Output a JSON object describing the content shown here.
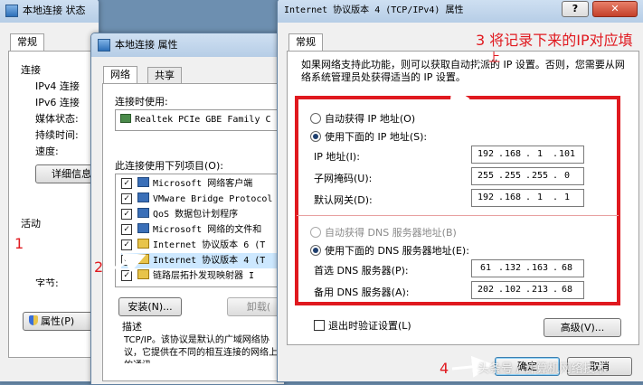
{
  "status_window": {
    "title": "本地连接 状态",
    "tab": "常规",
    "connection_label": "连接",
    "rows": [
      "IPv4 连接",
      "IPv6 连接",
      "媒体状态:",
      "持续时间:",
      "速度:"
    ],
    "details_button": "详细信息",
    "activity_label": "活动",
    "bytes_label": "字节:",
    "properties_button": "属性(P)"
  },
  "props_window": {
    "title": "本地连接 属性",
    "tabs": [
      "网络",
      "共享"
    ],
    "connect_using_label": "连接时使用:",
    "adapter": "Realtek PCIe GBE Family C",
    "items_label": "此连接使用下列项目(O):",
    "items": [
      "Microsoft 网络客户端",
      "VMware Bridge Protocol",
      "QoS 数据包计划程序",
      "Microsoft 网络的文件和",
      "Internet 协议版本 6 (T",
      "Internet 协议版本 4 (T",
      "链路层拓扑发现映射器 I"
    ],
    "install_button": "安装(N)...",
    "uninstall_button": "卸载(",
    "description_label": "描述",
    "description": "TCP/IP。该协议是默认的广域网络协议，它提供在不同的相互连接的网络上的通讯。"
  },
  "ipv4_dialog": {
    "title": "Internet 协议版本 4 (TCP/IPv4) 属性",
    "help_icon": "?",
    "close_icon": "✕",
    "tab": "常规",
    "intro": "如果网络支持此功能，则可以获取自动指派的 IP 设置。否则，您需要从网络系统管理员处获得适当的 IP 设置。",
    "auto_ip": "自动获得 IP 地址(O)",
    "manual_ip": "使用下面的 IP 地址(S):",
    "ip_label": "IP 地址(I):",
    "ip": [
      "192",
      "168",
      "1",
      "101"
    ],
    "mask_label": "子网掩码(U):",
    "mask": [
      "255",
      "255",
      "255",
      "0"
    ],
    "gateway_label": "默认网关(D):",
    "gateway": [
      "192",
      "168",
      "1",
      "1"
    ],
    "auto_dns": "自动获得 DNS 服务器地址(B)",
    "manual_dns": "使用下面的 DNS 服务器地址(E):",
    "dns1_label": "首选 DNS 服务器(P):",
    "dns1": [
      "61",
      "132",
      "163",
      "68"
    ],
    "dns2_label": "备用 DNS 服务器(A):",
    "dns2": [
      "202",
      "102",
      "213",
      "68"
    ],
    "validate_label": "退出时验证设置(L)",
    "advanced_button": "高级(V)...",
    "ok_button": "确定",
    "cancel_button": "取消"
  },
  "annotations": {
    "step1": "1",
    "step2": "2",
    "step3": "3 将记录下来的IP对应填",
    "step3_cont": "上",
    "step4": "4"
  },
  "watermark": "头条号 / 计算机网络技术",
  "colors": {
    "annotation_red": "#e0191f",
    "titlebar": "#c3d6ec"
  }
}
